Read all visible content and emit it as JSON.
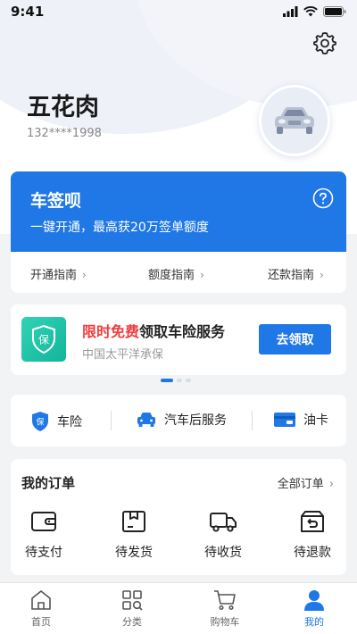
{
  "status_bar": {
    "time": "9:41"
  },
  "profile": {
    "name": "五花肉",
    "phone": "132****1998"
  },
  "chequbei": {
    "title": "车签呗",
    "subtitle": "一键开通，最高获20万签单额度",
    "guides": [
      "开通指南",
      "额度指南",
      "还款指南"
    ],
    "guide_arrow": "›"
  },
  "insurance_banner": {
    "highlight": "限时免费",
    "title_rest": "领取车险服务",
    "subtitle": "中国太平洋承保",
    "badge_char": "保",
    "button": "去领取"
  },
  "services": [
    {
      "label": "车险",
      "icon": "shield-icon"
    },
    {
      "label": "汽车后服务",
      "icon": "car-icon"
    },
    {
      "label": "油卡",
      "icon": "card-icon"
    }
  ],
  "orders": {
    "title": "我的订单",
    "all_label": "全部订单",
    "arrow": "›",
    "items": [
      {
        "label": "待支付",
        "icon": "wallet-icon"
      },
      {
        "label": "待发货",
        "icon": "package-icon"
      },
      {
        "label": "待收货",
        "icon": "truck-icon"
      },
      {
        "label": "待退款",
        "icon": "refund-icon"
      }
    ]
  },
  "tabbar": [
    {
      "label": "首页",
      "icon": "home-icon",
      "active": false
    },
    {
      "label": "分类",
      "icon": "category-icon",
      "active": false
    },
    {
      "label": "购物车",
      "icon": "cart-icon",
      "active": false
    },
    {
      "label": "我的",
      "icon": "user-icon",
      "active": true
    }
  ],
  "colors": {
    "primary": "#1f78e6",
    "highlight": "#f03c3c",
    "badge": "#1cc2a5"
  }
}
